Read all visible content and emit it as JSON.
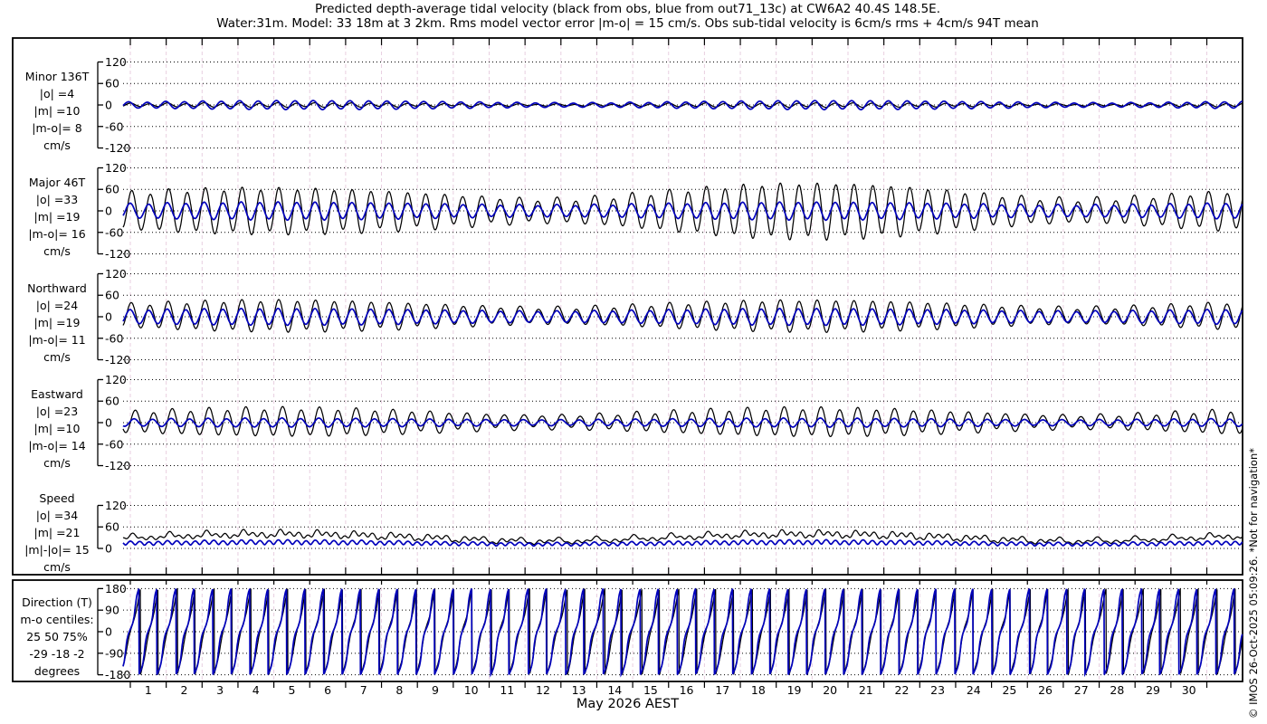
{
  "title": {
    "line1": "Predicted depth-average tidal velocity (black from obs, blue from out71_13c) at CW6A2 40.4S 148.5E.",
    "line2": "Water:31m. Model: 33 18m at 3 2km. Rms model vector error |m-o| = 15 cm/s. Obs sub-tidal velocity is 6cm/s rms + 4cm/s 94T mean"
  },
  "watermark": "© IMOS 26-Oct-2025 05:09:26. *Not for navigation*",
  "colors": {
    "obs": "#000000",
    "model": "#0000bb",
    "day_grid": "#e8cfe0",
    "value_grid": "#000000",
    "frame": "#000000"
  },
  "chart_data": {
    "type": "line",
    "x_axis": {
      "month_label": "May 2026 AEST",
      "day_labels": [
        "1",
        "2",
        "3",
        "4",
        "5",
        "6",
        "7",
        "8",
        "9",
        "10",
        "11",
        "12",
        "13",
        "14",
        "15",
        "16",
        "17",
        "18",
        "19",
        "20",
        "21",
        "22",
        "23",
        "24",
        "25",
        "26",
        "27",
        "28",
        "29",
        "30"
      ],
      "days_shown": 31,
      "grid": "on"
    },
    "legend": {
      "black": "obs",
      "blue": "model out71_13c"
    },
    "panels": [
      {
        "id": "minor",
        "label_lines": [
          "Minor 136T",
          "|o| =4",
          "|m| =10",
          "|m-o|= 8",
          "cm/s"
        ],
        "unit": "cm/s",
        "kind": "timeseries",
        "yticks": [
          120,
          60,
          0,
          -60,
          -120
        ],
        "ylim": [
          -120,
          120
        ],
        "series": [
          {
            "name": "obs",
            "color": "#000000",
            "mean": 0,
            "components": [
              [
                4,
                0.5175,
                0.3
              ],
              [
                1.5,
                0.5,
                4.8
              ],
              [
                1.2,
                0.9973,
                0.0
              ]
            ]
          },
          {
            "name": "model",
            "color": "#0000bb",
            "mean": 0,
            "components": [
              [
                9,
                0.5175,
                0.9
              ],
              [
                3,
                0.5,
                5.1
              ],
              [
                1.0,
                0.9973,
                0.5
              ]
            ]
          }
        ]
      },
      {
        "id": "major",
        "label_lines": [
          "Major 46T",
          "|o| =33",
          "|m| =19",
          "|m-o|= 16",
          "cm/s"
        ],
        "unit": "cm/s",
        "kind": "timeseries",
        "yticks": [
          120,
          60,
          0,
          -60,
          -120
        ],
        "ylim": [
          -120,
          120
        ],
        "series": [
          {
            "name": "obs",
            "color": "#000000",
            "mean": 0,
            "components": [
              [
                50,
                0.5175,
                0.0
              ],
              [
                18,
                0.5,
                4.5
              ],
              [
                7,
                0.5274,
                4.33
              ],
              [
                7,
                0.9973,
                0.0
              ]
            ]
          },
          {
            "name": "model",
            "color": "#0000bb",
            "mean": 0,
            "components": [
              [
                20,
                0.5175,
                0.25
              ],
              [
                4,
                0.5,
                4.75
              ],
              [
                2,
                0.9973,
                0.2
              ]
            ]
          }
        ]
      },
      {
        "id": "northward",
        "label_lines": [
          "Northward",
          "|o| =24",
          "|m| =19",
          "|m-o|= 11",
          "cm/s"
        ],
        "unit": "cm/s",
        "kind": "timeseries",
        "yticks": [
          120,
          60,
          0,
          -60,
          -120
        ],
        "ylim": [
          -120,
          120
        ],
        "series": [
          {
            "name": "obs",
            "color": "#000000",
            "mean": 3,
            "components": [
              [
                32,
                0.5175,
                0.0
              ],
              [
                10,
                0.5,
                4.5
              ],
              [
                5,
                0.9973,
                0.0
              ]
            ]
          },
          {
            "name": "model",
            "color": "#0000bb",
            "mean": 0,
            "components": [
              [
                19,
                0.5175,
                0.25
              ],
              [
                3.5,
                0.5,
                4.75
              ],
              [
                1.5,
                0.9973,
                0.2
              ]
            ]
          }
        ]
      },
      {
        "id": "eastward",
        "label_lines": [
          "Eastward",
          "|o| =23",
          "|m| =10",
          "|m-o|= 14",
          "cm/s"
        ],
        "unit": "cm/s",
        "kind": "timeseries",
        "yticks": [
          120,
          60,
          0,
          -60,
          -120
        ],
        "ylim": [
          -120,
          120
        ],
        "series": [
          {
            "name": "obs",
            "color": "#000000",
            "mean": 2,
            "components": [
              [
                28,
                0.5175,
                -1.3
              ],
              [
                10,
                0.5,
                3.2
              ],
              [
                5,
                0.9973,
                -1.3
              ]
            ]
          },
          {
            "name": "model",
            "color": "#0000bb",
            "mean": 0,
            "components": [
              [
                10,
                0.5175,
                -1.05
              ],
              [
                2,
                0.5,
                3.45
              ],
              [
                1,
                0.9973,
                -1.1
              ]
            ]
          }
        ]
      },
      {
        "id": "speed",
        "label_lines": [
          "Speed",
          "|o| =34",
          "|m| =21",
          "|m|-|o|= 15",
          "cm/s"
        ],
        "unit": "cm/s",
        "kind": "speed",
        "yticks": [
          120,
          60,
          0
        ],
        "ylim": [
          0,
          120
        ],
        "series": [
          {
            "name": "obs",
            "color": "#000000",
            "north": {
              "mean": 3,
              "components": [
                [
                  32,
                  0.5175,
                  0.0
                ],
                [
                  10,
                  0.5,
                  4.5
                ],
                [
                  5,
                  0.9973,
                  0.0
                ]
              ]
            },
            "east": {
              "mean": 2,
              "components": [
                [
                  28,
                  0.5175,
                  -1.3
                ],
                [
                  10,
                  0.5,
                  3.2
                ],
                [
                  5,
                  0.9973,
                  -1.3
                ]
              ]
            }
          },
          {
            "name": "model",
            "color": "#0000bb",
            "north": {
              "mean": 0,
              "components": [
                [
                  19,
                  0.5175,
                  0.25
                ],
                [
                  3.5,
                  0.5,
                  4.75
                ],
                [
                  1.5,
                  0.9973,
                  0.2
                ]
              ]
            },
            "east": {
              "mean": 0,
              "components": [
                [
                  10,
                  0.5175,
                  -1.05
                ],
                [
                  2,
                  0.5,
                  3.45
                ],
                [
                  1,
                  0.9973,
                  -1.1
                ]
              ]
            }
          }
        ]
      },
      {
        "id": "direction",
        "label_lines": [
          "Direction (T)",
          "m-o centiles:",
          "25  50  75%",
          "-29 -18  -2",
          "degrees"
        ],
        "unit": "degrees",
        "kind": "direction",
        "yticks": [
          180,
          90,
          0,
          -90,
          -180
        ],
        "ylim": [
          -180,
          180
        ],
        "series": [
          {
            "name": "obs",
            "color": "#000000",
            "north": {
              "mean": 3,
              "components": [
                [
                  32,
                  0.5175,
                  0.0
                ],
                [
                  10,
                  0.5,
                  4.5
                ],
                [
                  5,
                  0.9973,
                  0.0
                ]
              ]
            },
            "east": {
              "mean": 2,
              "components": [
                [
                  28,
                  0.5175,
                  -1.3
                ],
                [
                  10,
                  0.5,
                  3.2
                ],
                [
                  5,
                  0.9973,
                  -1.3
                ]
              ]
            }
          },
          {
            "name": "model",
            "color": "#0000bb",
            "north": {
              "mean": 0,
              "components": [
                [
                  19,
                  0.5175,
                  0.25
                ],
                [
                  3.5,
                  0.5,
                  4.75
                ],
                [
                  1.5,
                  0.9973,
                  0.2
                ]
              ]
            },
            "east": {
              "mean": 0,
              "components": [
                [
                  10,
                  0.5175,
                  -1.05
                ],
                [
                  2,
                  0.5,
                  3.45
                ],
                [
                  1,
                  0.9973,
                  -1.1
                ]
              ]
            }
          }
        ]
      }
    ]
  }
}
